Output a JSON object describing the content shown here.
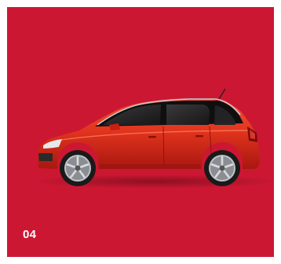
{
  "page": {
    "number": "04",
    "background_color": "#cc1733",
    "border_color": "#ffffff"
  },
  "image": {
    "subject": "car-side-view",
    "body_color": "#e2341e"
  }
}
